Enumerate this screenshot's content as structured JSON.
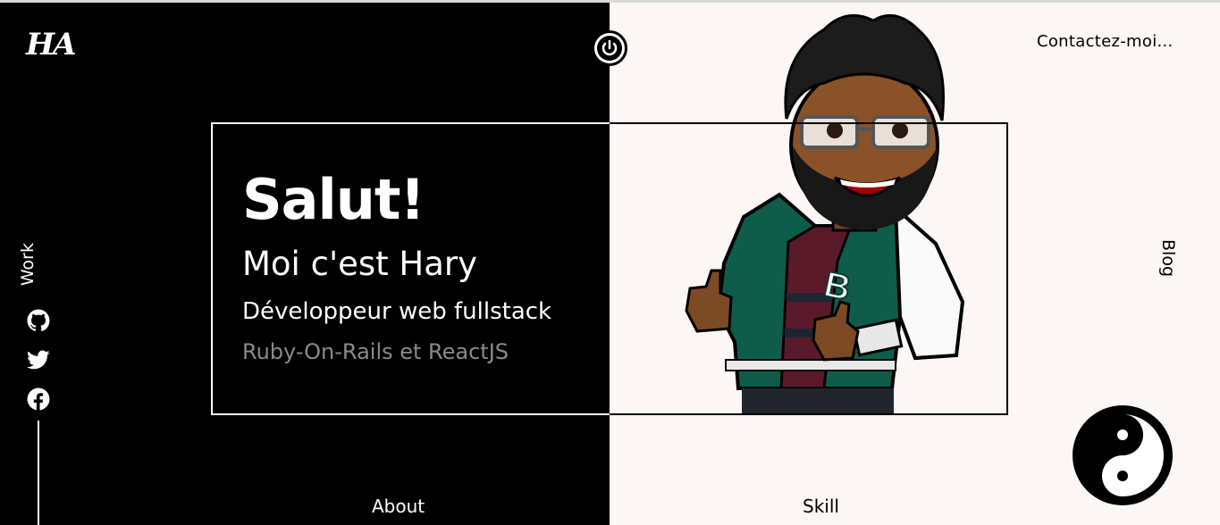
{
  "brand": {
    "logo_text": "HA"
  },
  "header": {
    "contact_label": "Contactez-moi..."
  },
  "nav": {
    "blog_label": "Blog",
    "work_label": "Work",
    "about_label": "About",
    "skill_label": "Skill"
  },
  "hero": {
    "greeting": "Salut!",
    "name_line": "Moi c'est Hary",
    "role": "Développeur web fullstack",
    "stack": "Ruby-On-Rails et ReactJS"
  },
  "social_icons": [
    "github-icon",
    "twitter-icon",
    "facebook-icon"
  ],
  "colors": {
    "dark_panel": "#000000",
    "light_panel": "#fcf6f4",
    "muted_text": "#8a8a8a",
    "jacket_green": "#0f5c4a"
  }
}
